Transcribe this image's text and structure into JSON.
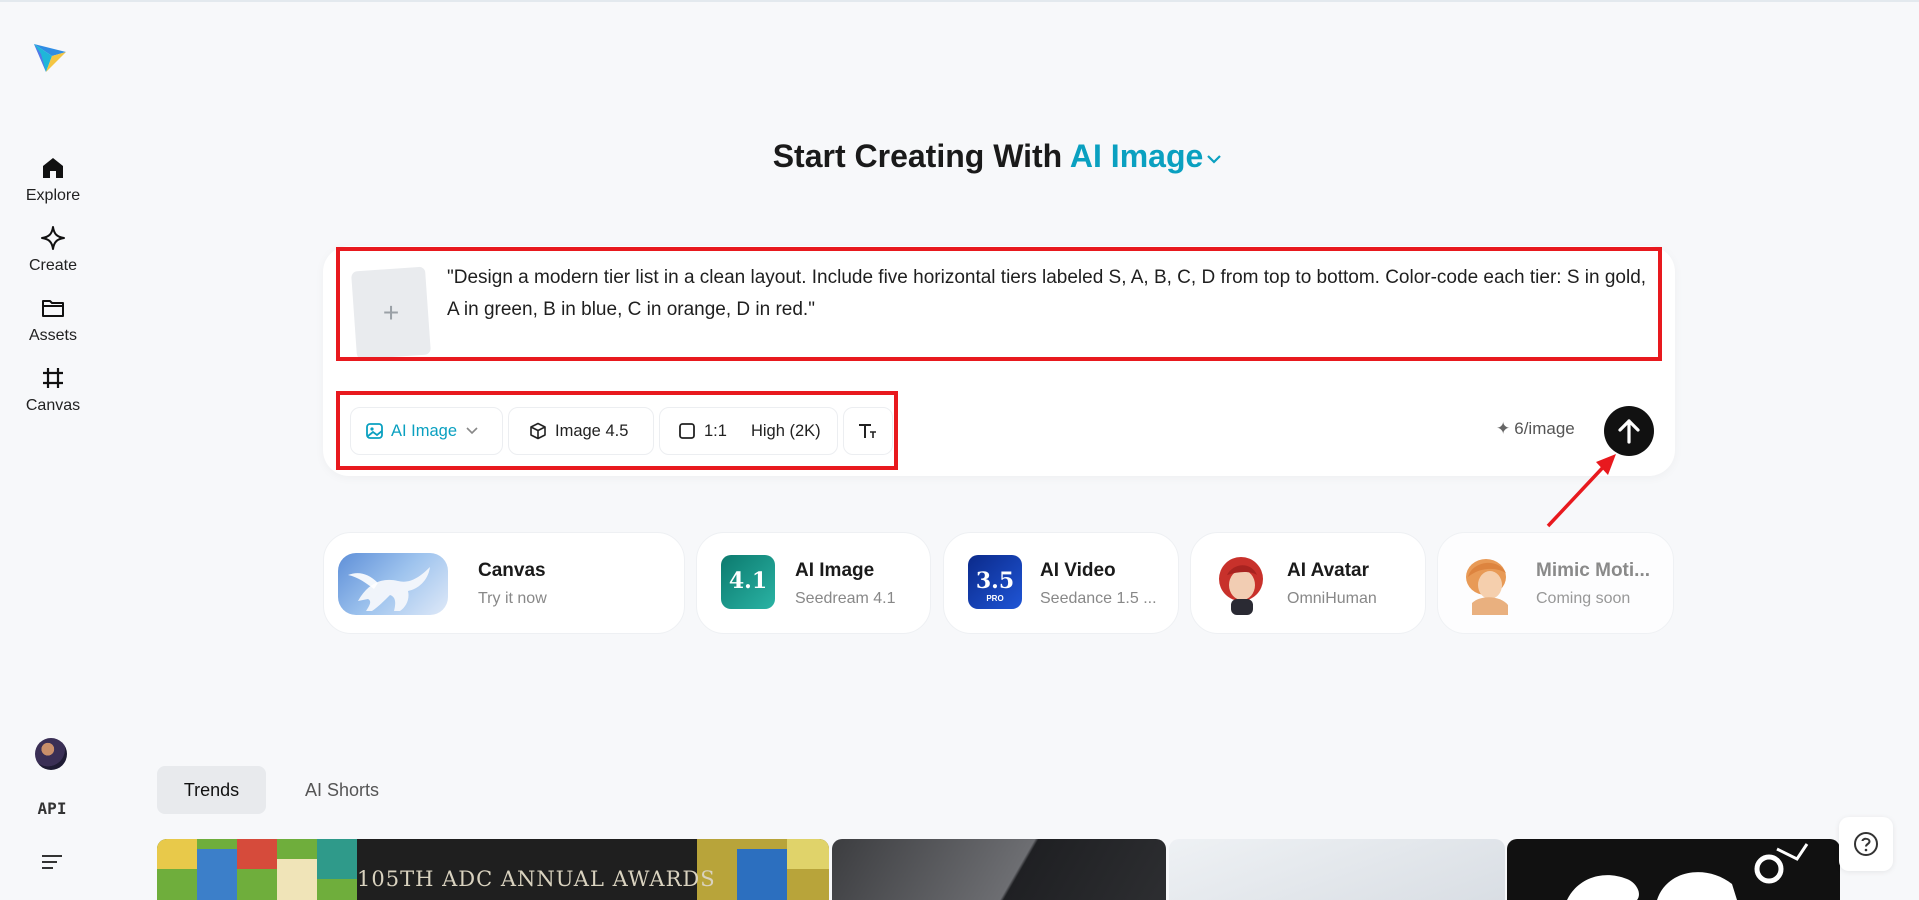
{
  "sidebar": {
    "items": [
      {
        "label": "Explore",
        "icon": "home-icon"
      },
      {
        "label": "Create",
        "icon": "diamond-icon"
      },
      {
        "label": "Assets",
        "icon": "folder-icon"
      },
      {
        "label": "Canvas",
        "icon": "frame-icon"
      }
    ],
    "api_label": "API"
  },
  "heading": {
    "prefix": "Start Creating With",
    "mode": "AI Image"
  },
  "prompt": {
    "upload_symbol": "+",
    "text": "\"Design a modern tier list in a clean layout. Include five horizontal tiers labeled S, A, B, C, D from top to bottom. Color-code each tier: S in gold, A in green, B in blue, C in orange, D in red.\""
  },
  "toolbar": {
    "mode_label": "AI Image",
    "model_label": "Image 4.5",
    "ratio_label": "1:1",
    "quality_label": "High (2K)",
    "credits_label": "6/image"
  },
  "features": [
    {
      "title": "Canvas",
      "subtitle": "Try it now"
    },
    {
      "title": "AI Image",
      "subtitle": "Seedream 4.1",
      "badge": "4.1"
    },
    {
      "title": "AI Video",
      "subtitle": "Seedance 1.5 ...",
      "badge": "3.5",
      "badge_sub": "PRO"
    },
    {
      "title": "AI Avatar",
      "subtitle": "OmniHuman"
    },
    {
      "title": "Mimic Moti...",
      "subtitle": "Coming soon"
    }
  ],
  "tabs": [
    {
      "label": "Trends",
      "active": true
    },
    {
      "label": "AI Shorts",
      "active": false
    }
  ],
  "gallery": {
    "item1_text": "105TH ADC ANNUAL AWARDS"
  },
  "colors": {
    "accent": "#0aa0c0",
    "annotation_red": "#e8191e",
    "send_button": "#111111"
  }
}
